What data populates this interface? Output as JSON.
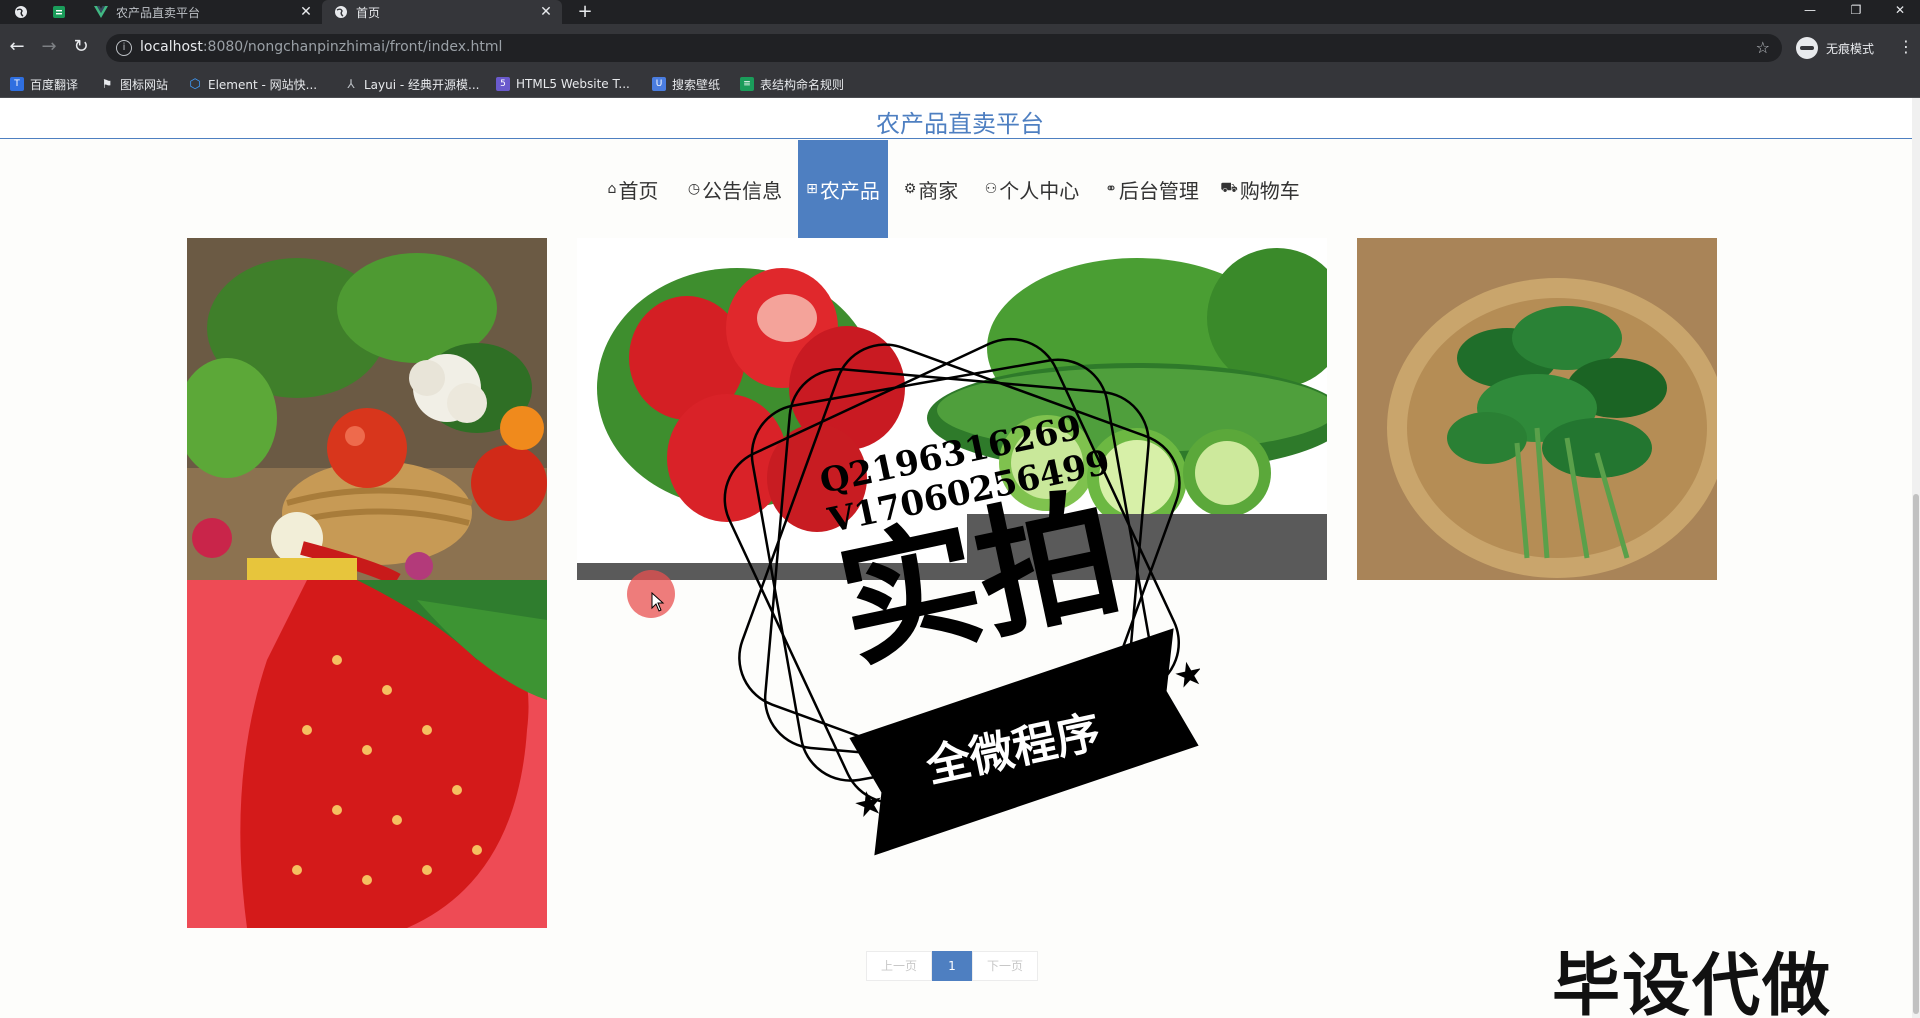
{
  "browser": {
    "tabs": [
      {
        "title": "农产品直卖平台",
        "active": false
      },
      {
        "title": "首页",
        "active": true
      }
    ],
    "url": {
      "host": "localhost",
      "rest": ":8080/nongchanpinzhimai/front/index.html"
    },
    "incognito_label": "无痕模式",
    "bookmarks": [
      {
        "label": "百度翻译",
        "icon": "baidu-translate-icon",
        "color": "#2f6fe0"
      },
      {
        "label": "图标网站",
        "icon": "flag-icon",
        "color": "#e8eaed"
      },
      {
        "label": "Element - 网站快...",
        "icon": "element-hex-icon",
        "color": "#409eff"
      },
      {
        "label": "Layui - 经典开源模...",
        "icon": "layui-icon",
        "color": "#9aa0a6"
      },
      {
        "label": "HTML5 Website T...",
        "icon": "html5-icon",
        "color": "#6a5acd"
      },
      {
        "label": "搜索壁纸",
        "icon": "wallpaper-search-icon",
        "color": "#4a7de0"
      },
      {
        "label": "表结构命名规则",
        "icon": "table-icon",
        "color": "#1a9c5a"
      }
    ]
  },
  "site": {
    "title": "农产品直卖平台",
    "nav": [
      {
        "label": "首页",
        "icon": "home-icon",
        "glyph": "⌂",
        "active": false
      },
      {
        "label": "公告信息",
        "icon": "clock-icon",
        "glyph": "◷",
        "active": false
      },
      {
        "label": "农产品",
        "icon": "grid-icon",
        "glyph": "⊞",
        "active": true
      },
      {
        "label": "商家",
        "icon": "gear-icon",
        "glyph": "⚙",
        "active": false
      },
      {
        "label": "个人中心",
        "icon": "user-icon",
        "glyph": "⚇",
        "active": false
      },
      {
        "label": "后台管理",
        "icon": "link-icon",
        "glyph": "⚭",
        "active": false
      },
      {
        "label": "购物车",
        "icon": "cart-icon",
        "glyph": "⛟",
        "active": false
      }
    ],
    "pagination": {
      "prev": "上一页",
      "current": "1",
      "next": "下一页"
    }
  },
  "watermark": {
    "line1": "Q2196316269",
    "line2": "V17060256499",
    "big": "实拍",
    "banner": "全微程序",
    "corner": "毕设代做"
  },
  "colors": {
    "accent": "#4e7fc1"
  }
}
